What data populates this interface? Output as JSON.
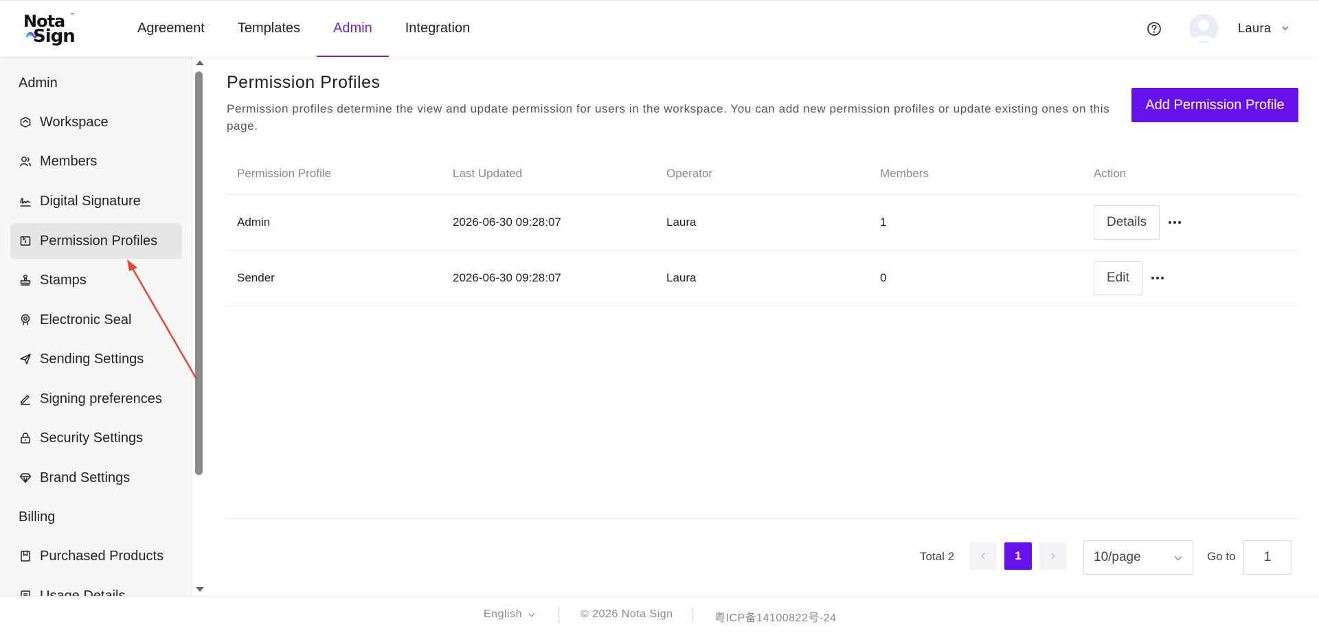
{
  "app": {
    "logo_top": "Nota",
    "logo_bottom": "Sign",
    "logo_tm": "™"
  },
  "nav": {
    "tabs": [
      {
        "label": "Agreement",
        "active": false
      },
      {
        "label": "Templates",
        "active": false
      },
      {
        "label": "Admin",
        "active": true
      },
      {
        "label": "Integration",
        "active": false
      }
    ]
  },
  "user": {
    "name": "Laura"
  },
  "sidebar": {
    "sections": [
      {
        "label": "Admin"
      },
      {
        "label": "Billing"
      }
    ],
    "items": [
      {
        "label": "Workspace",
        "icon": "workspace-icon"
      },
      {
        "label": "Members",
        "icon": "members-icon"
      },
      {
        "label": "Digital Signature",
        "icon": "signature-icon"
      },
      {
        "label": "Permission Profiles",
        "icon": "permission-icon",
        "active": true
      },
      {
        "label": "Stamps",
        "icon": "stamp-icon"
      },
      {
        "label": "Electronic Seal",
        "icon": "seal-icon"
      },
      {
        "label": "Sending Settings",
        "icon": "send-icon"
      },
      {
        "label": "Signing preferences",
        "icon": "pen-icon"
      },
      {
        "label": "Security Settings",
        "icon": "lock-icon"
      },
      {
        "label": "Brand Settings",
        "icon": "diamond-icon"
      },
      {
        "label": "Purchased Products",
        "icon": "bookmark-icon"
      },
      {
        "label": "Usage Details",
        "icon": "list-icon"
      }
    ]
  },
  "main": {
    "title": "Permission Profiles",
    "description": "Permission profiles determine the view and update permission for users in the workspace. You can add new permission profiles or update existing ones on this page.",
    "add_button": "Add Permission Profile",
    "table": {
      "columns": [
        "Permission Profile",
        "Last Updated",
        "Operator",
        "Members",
        "Action"
      ],
      "rows": [
        {
          "profile": "Admin",
          "updated": "2026-06-30 09:28:07",
          "operator": "Laura",
          "members": "1",
          "action": "Details"
        },
        {
          "profile": "Sender",
          "updated": "2026-06-30 09:28:07",
          "operator": "Laura",
          "members": "0",
          "action": "Edit"
        }
      ]
    },
    "pagination": {
      "total": "Total 2",
      "current": "1",
      "page_size": "10/page",
      "goto_label": "Go to",
      "goto_value": "1"
    }
  },
  "footer": {
    "language": "English",
    "copyright": "© 2026 Nota Sign",
    "icp": "粤ICP备14100822号-24"
  },
  "colors": {
    "accent": "#6611ee",
    "nav_active": "#6b21e8",
    "annotation_arrow": "#e8472f"
  }
}
